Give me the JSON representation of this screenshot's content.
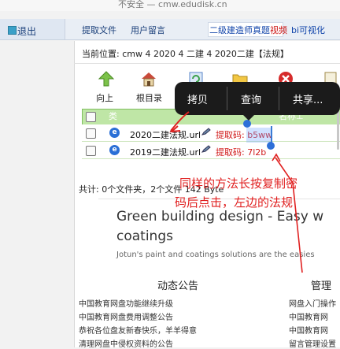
{
  "browser": {
    "url_text": "不安全 — cmw.edudisk.cn"
  },
  "nav": {
    "logout": "退出",
    "links": [
      "提取文件",
      "用户留言"
    ],
    "video_prefix": "二级建造师真题",
    "video_suffix": "视频",
    "bi": "bi可视化"
  },
  "location": "当前位置:   cmw 4 2020 4 二建 4 2020二建【法规】",
  "toolbar": {
    "up": "向上",
    "root": "根目录"
  },
  "table": {
    "header_type": "类",
    "header_name": "名称⊥",
    "rows": [
      {
        "name": "2020二建法规.url",
        "code": "提取码: b5ww"
      },
      {
        "name": "2019二建法规.url",
        "code": "提取码: 7l2b"
      }
    ]
  },
  "summary": "共计: 0个文件夹，2个文件 142 Byte",
  "popup": {
    "copy": "拷贝",
    "lookup": "查询",
    "share": "共享..."
  },
  "annotation": {
    "line1": "同样的方法长按复制密",
    "line2": "码后点击，左边的法规"
  },
  "ad": {
    "title_line1": "Green building design - Easy w",
    "title_line2": "coatings",
    "subtitle": "Jotun's paint and coatings solutions are the easies"
  },
  "news": {
    "heading": "动态公告",
    "items": [
      "中国教育网盘功能继续升级",
      "中国教育网盘费用调整公告",
      "恭祝各位盘友新春快乐，羊羊得意",
      "清理网盘中侵权资料的公告"
    ]
  },
  "mgmt": {
    "heading": "管理",
    "items": [
      "网盘入门操作",
      "中国教育网",
      "中国教育网",
      "留言管理设置"
    ]
  },
  "colors": {
    "accent_green": "#bfe6a6",
    "annotation_red": "#e02020",
    "code_red": "#d01a1a"
  }
}
